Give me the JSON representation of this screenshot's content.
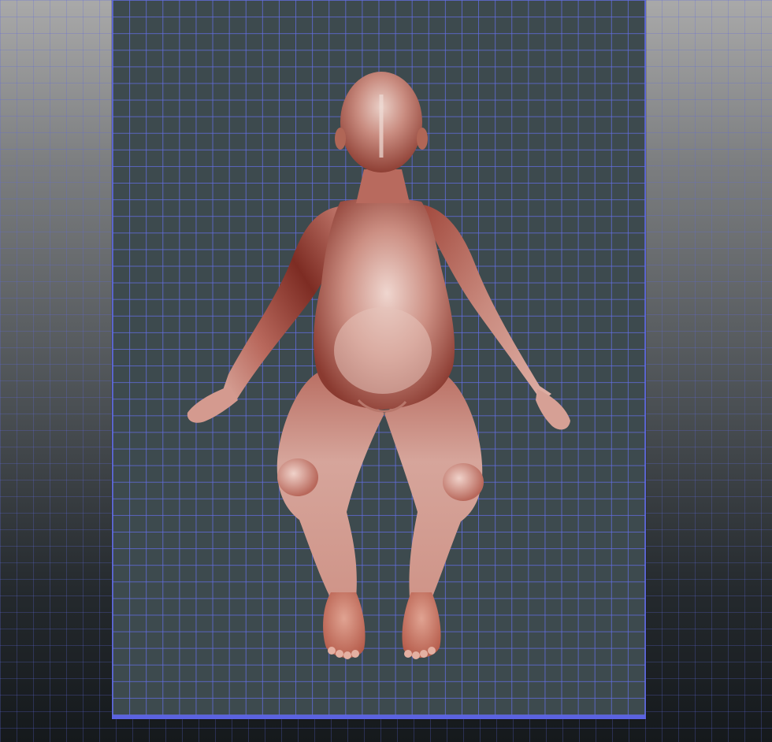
{
  "viewport": {
    "name": "3d-viewport",
    "background": "gradient-grey-to-dark",
    "grid_color": "#5a64d8",
    "backplane_color": "#3d4a4e"
  },
  "model": {
    "name": "seated-child-figure",
    "skin_color": "#b86a5e",
    "highlight_color": "#e8b8ae",
    "shadow_color": "#7a2e26"
  }
}
